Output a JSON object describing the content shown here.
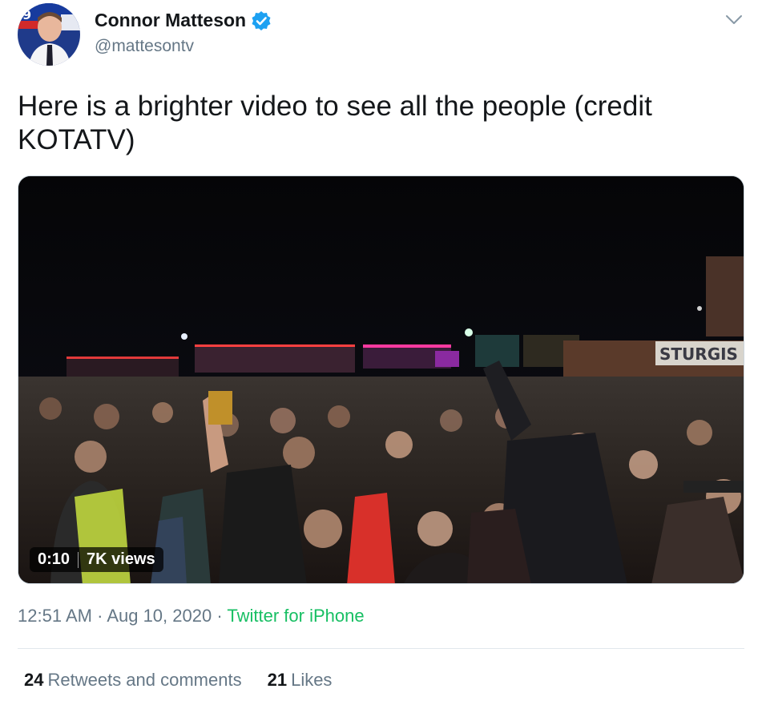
{
  "author": {
    "display_name": "Connor Matteson",
    "handle": "@mattesontv",
    "verified": true
  },
  "tweet": {
    "text": "Here is a brighter video to see all the people (credit KOTATV)"
  },
  "media": {
    "duration": "0:10",
    "views": "7K views",
    "sign_text": "STURGIS B"
  },
  "meta": {
    "time": "12:51 AM",
    "separator": "·",
    "date": "Aug 10, 2020",
    "source": "Twitter for iPhone"
  },
  "stats": {
    "retweets_count": "24",
    "retweets_label": "Retweets and comments",
    "likes_count": "21",
    "likes_label": "Likes"
  },
  "colors": {
    "verified_badge": "#1da1f2",
    "source_link": "#17bf63",
    "secondary_text": "#657786"
  },
  "icons": [
    "verified-badge-icon",
    "chevron-down-icon"
  ]
}
